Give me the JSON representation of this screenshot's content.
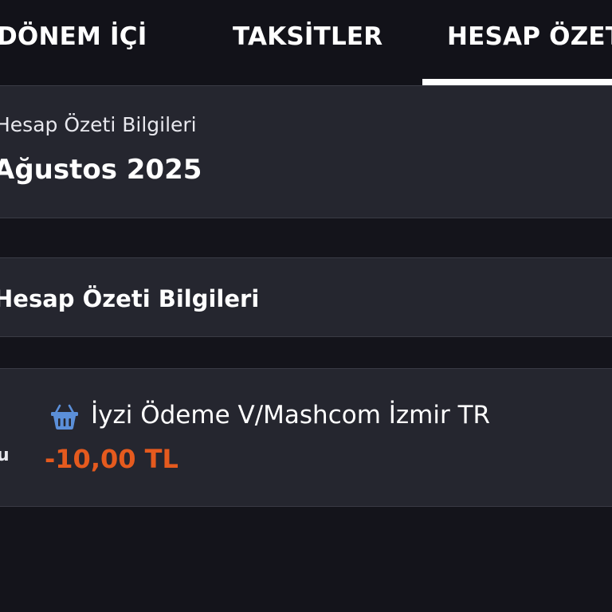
{
  "tabs": {
    "donem": "DÖNEM İÇİ",
    "taksit": "TAKSİTLER",
    "hesap": "HESAP ÖZETİ"
  },
  "summary": {
    "label": "Hesap Özeti Bilgileri",
    "period": "Ağustos 2025"
  },
  "section": {
    "title": "Hesap Özeti Bilgileri"
  },
  "transaction": {
    "side_text": "u",
    "icon": "basket-icon",
    "merchant": "İyzi Ödeme V/Mashcom İzmir TR",
    "amount": "-10,00 TL",
    "amount_color": "#e55a1e"
  },
  "colors": {
    "background": "#14141b",
    "card": "#25262f",
    "tab_indicator": "#ffffff",
    "icon_blue": "#5b8fd9"
  }
}
